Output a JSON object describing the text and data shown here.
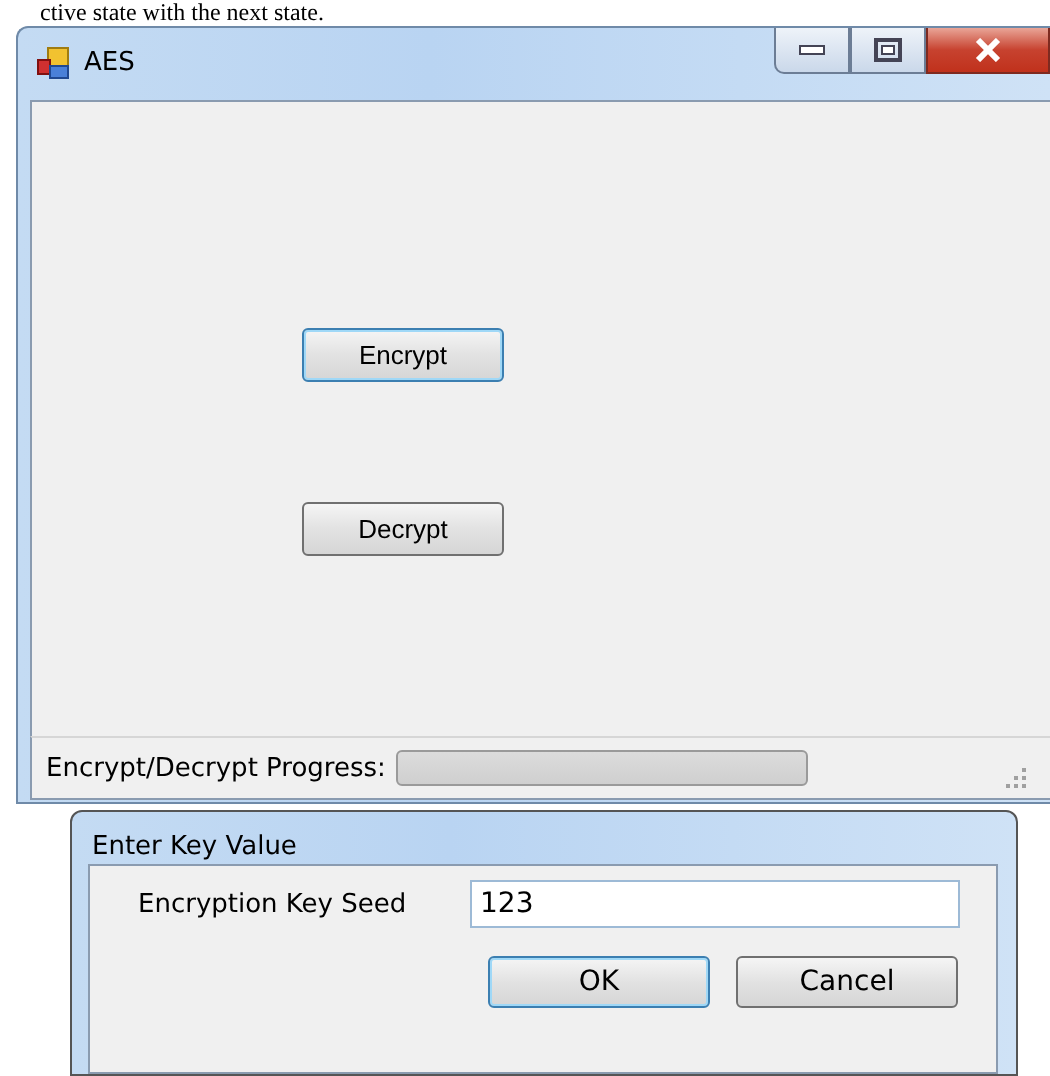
{
  "caption_fragment": "ctive state with the next state.",
  "window": {
    "title": "AES",
    "buttons": [
      {
        "label": "Encrypt",
        "focused": true
      },
      {
        "label": "Decrypt",
        "focused": false
      }
    ],
    "status_bar": {
      "label": "Encrypt/Decrypt Progress:",
      "progress": {
        "level": 0
      }
    }
  },
  "dialog": {
    "title": "Enter Key Value",
    "field": {
      "label": "Encryption Key Seed",
      "value": "123"
    },
    "buttons": [
      {
        "label": "OK",
        "default": true
      },
      {
        "label": "Cancel",
        "default": false
      }
    ]
  }
}
